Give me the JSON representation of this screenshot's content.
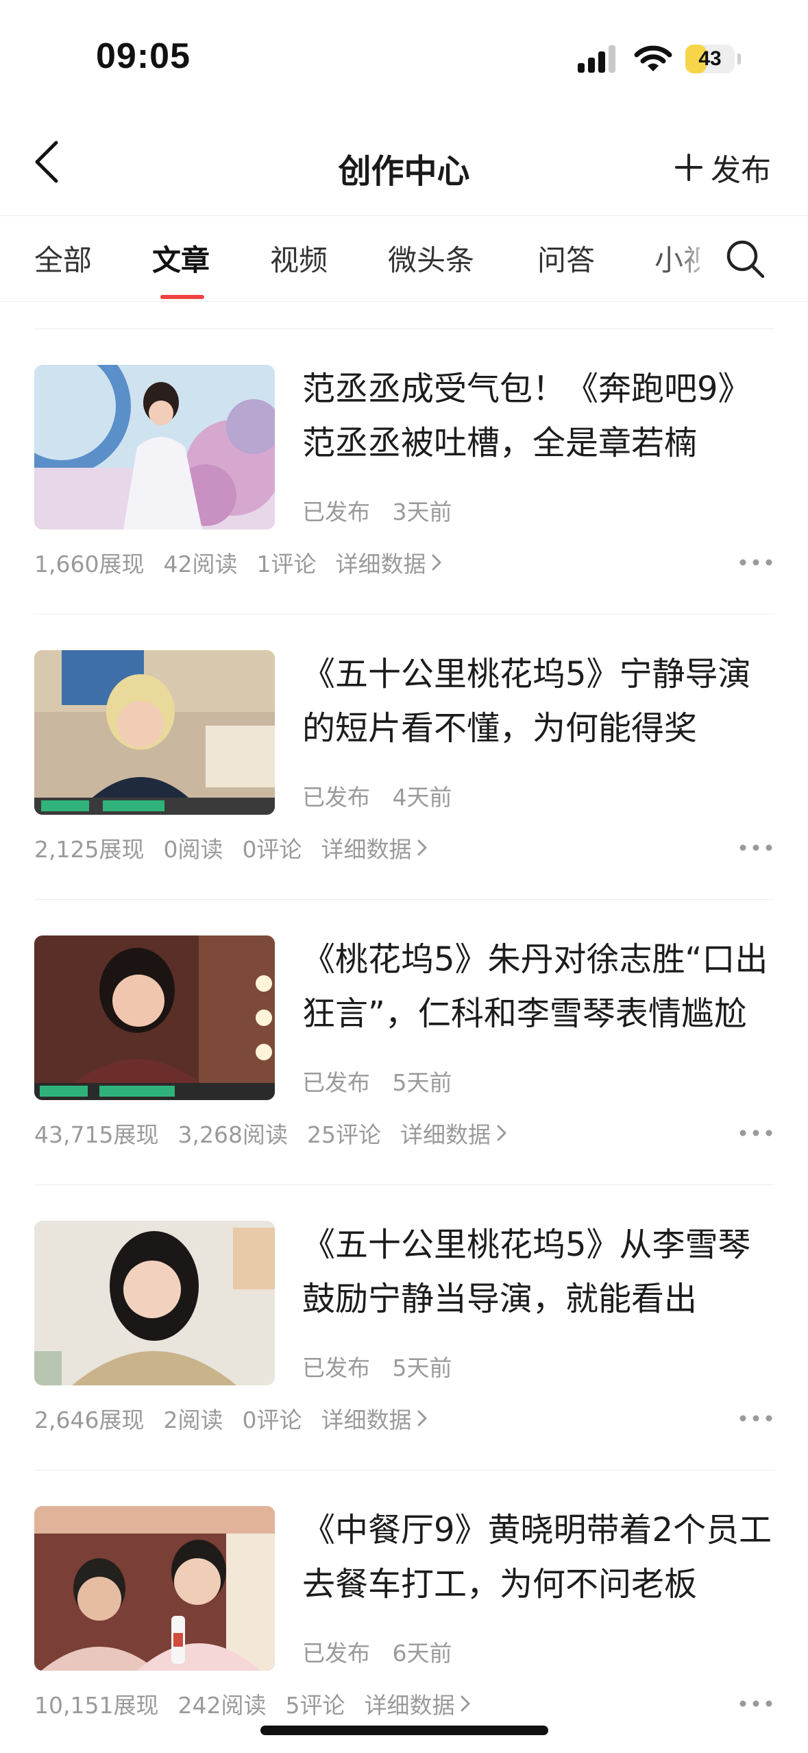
{
  "status_bar": {
    "time": "09:05",
    "battery": "43",
    "battery_level": 0.43
  },
  "nav": {
    "title": "创作中心",
    "publish_label": "发布"
  },
  "tabs": [
    {
      "label": "全部"
    },
    {
      "label": "文章"
    },
    {
      "label": "视频"
    },
    {
      "label": "微头条"
    },
    {
      "label": "问答"
    },
    {
      "label": "小视"
    }
  ],
  "active_tab": "文章",
  "articles": [
    {
      "title": "范丞丞成受气包！《奔跑吧9》范丞丞被吐槽，全是章若楠",
      "status": "已发布",
      "time": "3天前",
      "impressions": "1,660展现",
      "reads": "42阅读",
      "comments": "1评论",
      "detail": "详细数据"
    },
    {
      "title": "《五十公里桃花坞5》宁静导演的短片看不懂，为何能得奖",
      "status": "已发布",
      "time": "4天前",
      "impressions": "2,125展现",
      "reads": "0阅读",
      "comments": "0评论",
      "detail": "详细数据"
    },
    {
      "title": "《桃花坞5》朱丹对徐志胜“口出狂言”，仁科和李雪琴表情尴尬",
      "status": "已发布",
      "time": "5天前",
      "impressions": "43,715展现",
      "reads": "3,268阅读",
      "comments": "25评论",
      "detail": "详细数据"
    },
    {
      "title": "《五十公里桃花坞5》从李雪琴鼓励宁静当导演，就能看出",
      "status": "已发布",
      "time": "5天前",
      "impressions": "2,646展现",
      "reads": "2阅读",
      "comments": "0评论",
      "detail": "详细数据"
    },
    {
      "title": "《中餐厅9》黄晓明带着2个员工去餐车打工，为何不问老板",
      "status": "已发布",
      "time": "6天前",
      "impressions": "10,151展现",
      "reads": "242阅读",
      "comments": "5评论",
      "detail": "详细数据"
    }
  ]
}
